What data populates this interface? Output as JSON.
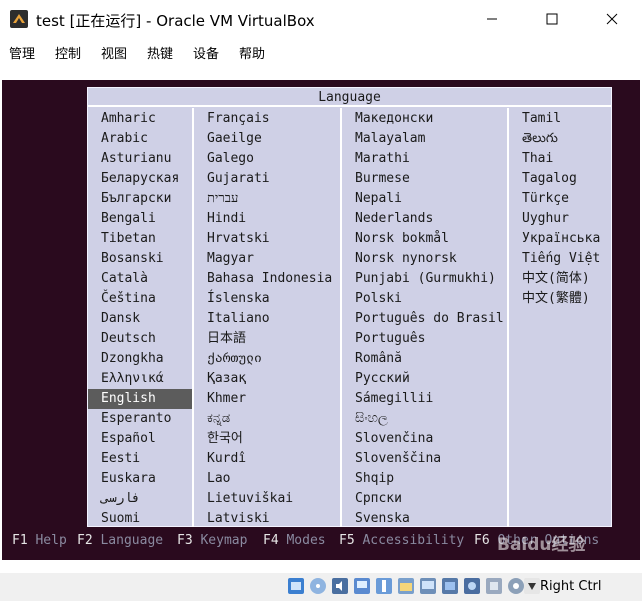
{
  "window": {
    "title": "test [正在运行] - Oracle VM VirtualBox",
    "minimize_icon": "minimize-icon",
    "maximize_icon": "maximize-icon",
    "close_icon": "close-icon"
  },
  "menubar": {
    "items": [
      "管理",
      "控制",
      "视图",
      "热键",
      "设备",
      "帮助"
    ]
  },
  "installer": {
    "header": "Language",
    "columns": [
      [
        "Amharic",
        "Arabic",
        "Asturianu",
        "Беларуская",
        "Български",
        "Bengali",
        "Tibetan",
        "Bosanski",
        "Català",
        "Čeština",
        "Dansk",
        "Deutsch",
        "Dzongkha",
        "Ελληνικά",
        "English",
        "Esperanto",
        "Español",
        "Eesti",
        "Euskara",
        "فارسی",
        "Suomi"
      ],
      [
        "Français",
        "Gaeilge",
        "Galego",
        "Gujarati",
        "עברית",
        "Hindi",
        "Hrvatski",
        "Magyar",
        "Bahasa Indonesia",
        "Íslenska",
        "Italiano",
        "日本語",
        "ქართული",
        "Қазақ",
        "Khmer",
        "ಕನ್ನಡ",
        "한국어",
        "Kurdî",
        "Lao",
        "Lietuviškai",
        "Latviski"
      ],
      [
        "Македонски",
        "Malayalam",
        "Marathi",
        "Burmese",
        "Nepali",
        "Nederlands",
        "Norsk bokmål",
        "Norsk nynorsk",
        "Punjabi (Gurmukhi)",
        "Polski",
        "Português do Brasil",
        "Português",
        "Română",
        "Русский",
        "Sámegillii",
        "සිංහල",
        "Slovenčina",
        "Slovenščina",
        "Shqip",
        "Српски",
        "Svenska"
      ],
      [
        "Tamil",
        "తెలుగు",
        "Thai",
        "Tagalog",
        "Türkçe",
        "Uyghur",
        "Українська",
        "Tiếng Việt",
        "中文(简体)",
        "中文(繁體)"
      ]
    ],
    "selected": "English",
    "fkeys": [
      {
        "key": "F1",
        "label": "Help"
      },
      {
        "key": "F2",
        "label": "Language"
      },
      {
        "key": "F3",
        "label": "Keymap"
      },
      {
        "key": "F4",
        "label": "Modes"
      },
      {
        "key": "F5",
        "label": "Accessibility"
      },
      {
        "key": "F6",
        "label": "Other Options"
      }
    ]
  },
  "statusbar": {
    "host_key": "Right Ctrl",
    "icons": [
      "hard-disk-icon",
      "optical-drive-icon",
      "audio-icon",
      "network-icon",
      "usb-icon",
      "shared-folder-icon",
      "display-icon",
      "video-capture-icon",
      "recording-icon",
      "cpu-icon",
      "mouse-integration-icon",
      "arrow-down-icon"
    ]
  },
  "watermark": "Baidu经验",
  "colors": {
    "vm_background": "#2a0a1e",
    "menu_panel": "#cfd0e6",
    "selection": "#5c5c5c"
  }
}
